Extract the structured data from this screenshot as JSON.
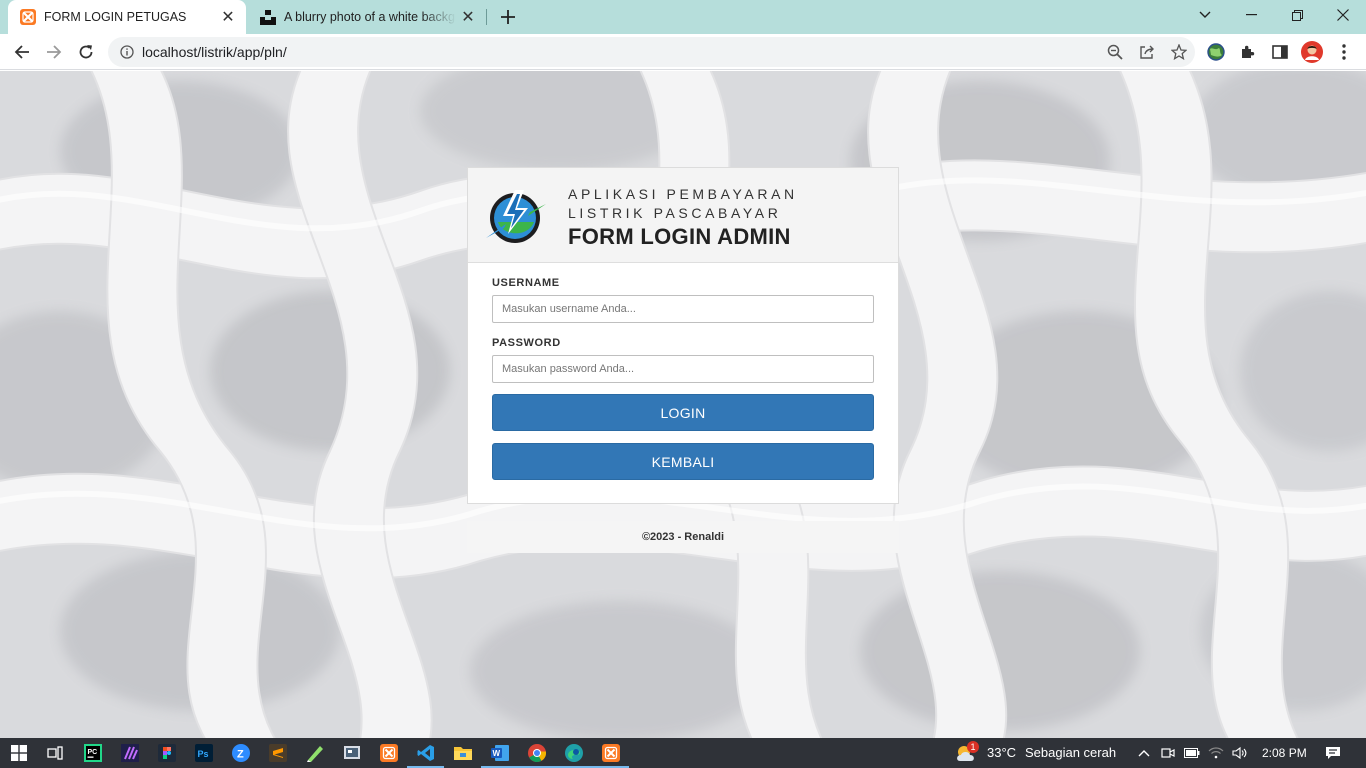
{
  "browser": {
    "tabs": [
      {
        "title": "FORM LOGIN PETUGAS",
        "active": true
      },
      {
        "title": "A blurry photo of a white background",
        "active": false
      }
    ],
    "url": "localhost/listrik/app/pln/"
  },
  "login": {
    "app_line1": "APLIKASI PEMBAYARAN",
    "app_line2": "LISTRIK PASCABAYAR",
    "title": "FORM LOGIN ADMIN",
    "username_label": "USERNAME",
    "username_placeholder": "Masukan username Anda...",
    "password_label": "PASSWORD",
    "password_placeholder": "Masukan password Anda...",
    "login_button": "LOGIN",
    "back_button": "KEMBALI",
    "footer": "©2023 - Renaldi"
  },
  "taskbar": {
    "weather_badge": "1",
    "temperature": "33°C",
    "condition": "Sebagian cerah",
    "time": "2:08 PM"
  },
  "colors": {
    "tab_strip": "#b6dedb",
    "button_blue": "#3277b6",
    "taskbar": "#2f3238"
  }
}
